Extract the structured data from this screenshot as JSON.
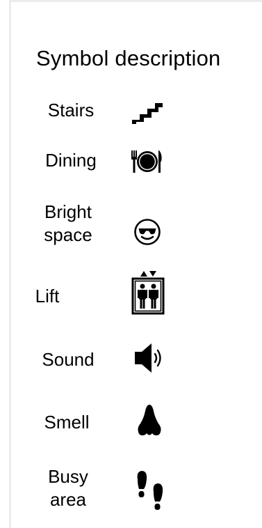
{
  "title": "Symbol description",
  "items": [
    {
      "label": "Stairs",
      "icon": "stairs-icon"
    },
    {
      "label": "Dining",
      "icon": "dining-icon"
    },
    {
      "label": "Bright space",
      "label_lines": [
        "Bright",
        "space"
      ],
      "icon": "sunglasses-face-icon"
    },
    {
      "label": "Lift",
      "icon": "elevator-icon"
    },
    {
      "label": "Sound",
      "icon": "speaker-icon"
    },
    {
      "label": "Smell",
      "icon": "nose-icon"
    },
    {
      "label": "Busy area",
      "label_lines": [
        "Busy",
        "area"
      ],
      "icon": "footprints-icon"
    }
  ]
}
